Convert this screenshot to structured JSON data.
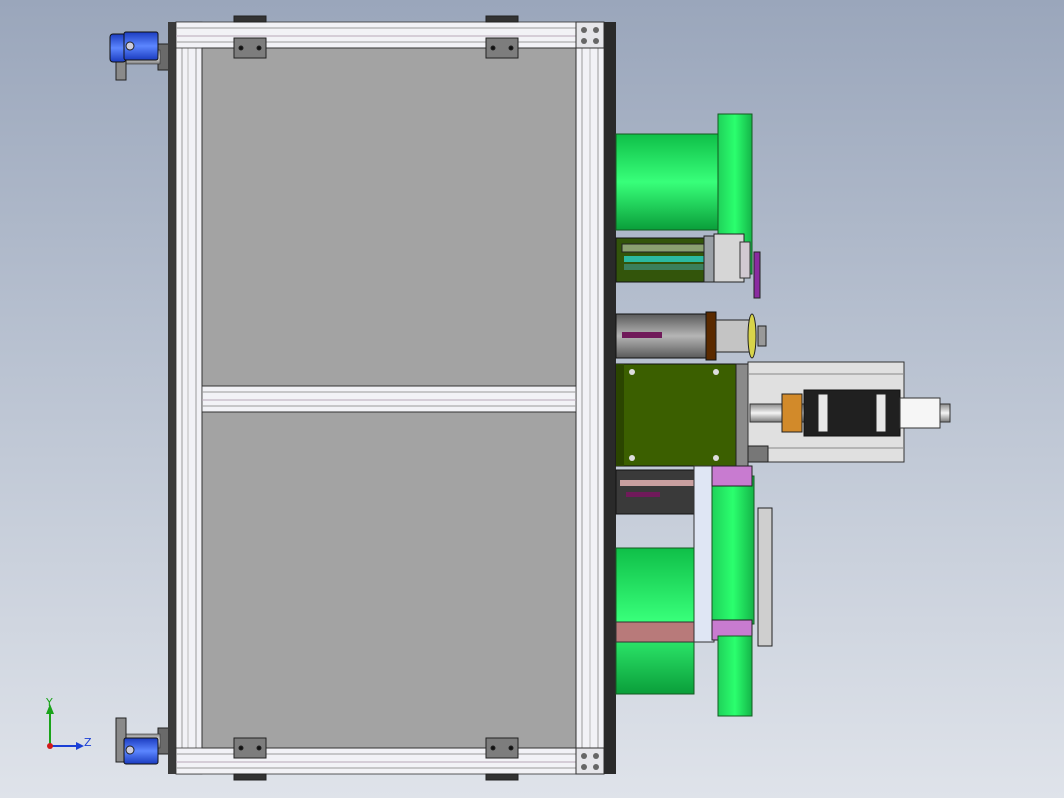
{
  "view": {
    "background_top": "#9aa6bb",
    "background_bottom": "#dfe3ea"
  },
  "colors": {
    "frame_aluminum": "#e8e8ee",
    "frame_slot": "#c9c9d2",
    "panel_gray": "#a3a3a3",
    "motor_green": "#10e85a",
    "plate_green": "#3b5f00",
    "bracket_purple": "#c87bd0",
    "caster_blue": "#2a4fd0",
    "dark_plate": "#2a2a2a"
  },
  "triad": {
    "y_label": "Y",
    "z_label": "Z",
    "y_color": "#1aa31a",
    "z_color": "#1a3fd6",
    "x_dot_color": "#d21a1a"
  }
}
